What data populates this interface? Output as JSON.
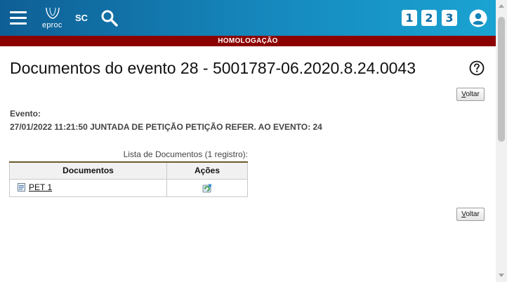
{
  "header": {
    "logo_text": "eproc",
    "state": "SC",
    "quick_buttons": [
      "1",
      "2",
      "3"
    ],
    "icons": {
      "menu": "hamburger-menu-icon",
      "search": "search-icon",
      "user": "user-account-icon"
    },
    "colors": {
      "bar_start": "#0e5f95",
      "bar_end": "#1aa3d2"
    }
  },
  "environment_banner": {
    "text": "HOMOLOGAÇÃO",
    "color": "#8b0000"
  },
  "page": {
    "title": "Documentos do evento 28 - 5001787-06.2020.8.24.0043",
    "help_icon": "help-circle-icon",
    "back_label_first": "V",
    "back_label_rest": "oltar"
  },
  "event": {
    "label": "Evento:",
    "value": "27/01/2022 11:21:50 JUNTADA DE PETIÇÃO PETIÇÃO REFER. AO EVENTO: 24"
  },
  "documents_table": {
    "caption": "Lista de Documentos (1 registro):",
    "headers": [
      "Documentos",
      "Ações"
    ],
    "rows": [
      {
        "document": "PET 1",
        "document_icon": "document-file-icon",
        "action_icon": "refresh-recycle-icon"
      }
    ]
  }
}
